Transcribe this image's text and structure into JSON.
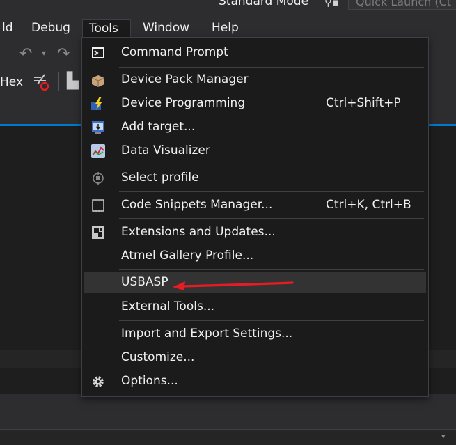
{
  "title_bar": {
    "mode": "Standard Mode",
    "quick_launch_placeholder": "Quick Launch (Ct"
  },
  "menubar": {
    "items": [
      {
        "label": "ld"
      },
      {
        "label": "Debug"
      },
      {
        "label": "Tools"
      },
      {
        "label": "Window"
      },
      {
        "label": "Help"
      }
    ]
  },
  "toolbar": {
    "hex_label": "Hex"
  },
  "tools_menu": {
    "items": [
      {
        "label": "Command Prompt",
        "shortcut": "",
        "icon": "command-prompt-icon"
      },
      {
        "label": "Device Pack Manager",
        "shortcut": "",
        "icon": "package-icon"
      },
      {
        "label": "Device Programming",
        "shortcut": "Ctrl+Shift+P",
        "icon": "lightning-icon"
      },
      {
        "label": "Add target...",
        "shortcut": "",
        "icon": "add-target-icon"
      },
      {
        "label": "Data Visualizer",
        "shortcut": "",
        "icon": "chart-icon"
      },
      {
        "label": "Select profile",
        "shortcut": "",
        "icon": "profile-icon"
      },
      {
        "label": "Code Snippets Manager...",
        "shortcut": "Ctrl+K, Ctrl+B",
        "icon": "snippet-icon"
      },
      {
        "label": "Extensions and Updates...",
        "shortcut": "",
        "icon": "extensions-icon"
      },
      {
        "label": "Atmel Gallery Profile...",
        "shortcut": "",
        "icon": ""
      },
      {
        "label": "USBASP",
        "shortcut": "",
        "icon": ""
      },
      {
        "label": "External Tools...",
        "shortcut": "",
        "icon": ""
      },
      {
        "label": "Import and Export Settings...",
        "shortcut": "",
        "icon": ""
      },
      {
        "label": "Customize...",
        "shortcut": "",
        "icon": ""
      },
      {
        "label": "Options...",
        "shortcut": "",
        "icon": "gear-icon"
      }
    ]
  },
  "colors": {
    "accent": "#007acc",
    "arrow": "#e51c23",
    "menu_bg": "#1b1b1c",
    "highlight": "#333334"
  }
}
